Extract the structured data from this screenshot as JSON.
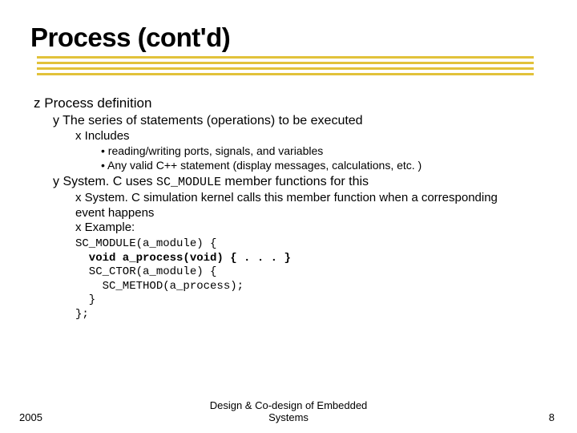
{
  "title": "Process (cont'd)",
  "lvl1": "Process definition",
  "lvl2a": "The series of statements (operations) to be executed",
  "lvl3a": "Includes",
  "lvl4a": "reading/writing ports, signals, and variables",
  "lvl4b": "Any valid C++ statement (display messages, calculations, etc. )",
  "lvl2b_pre": "System. C uses ",
  "lvl2b_code": "SC_MODULE",
  "lvl2b_post": " member functions for this",
  "lvl3b": "System. C simulation kernel calls this member function when a corresponding event happens",
  "lvl3c": "Example:",
  "code_l1": "SC_MODULE(a_module) {",
  "code_l2": "  void a_process(void) { . . . }",
  "code_l3": "  SC_CTOR(a_module) {",
  "code_l4": "    SC_METHOD(a_process);",
  "code_l5": "  }",
  "code_l6": "};",
  "footer_left": "2005",
  "footer_center_l1": "Design & Co-design of Embedded",
  "footer_center_l2": "Systems",
  "footer_right": "8"
}
